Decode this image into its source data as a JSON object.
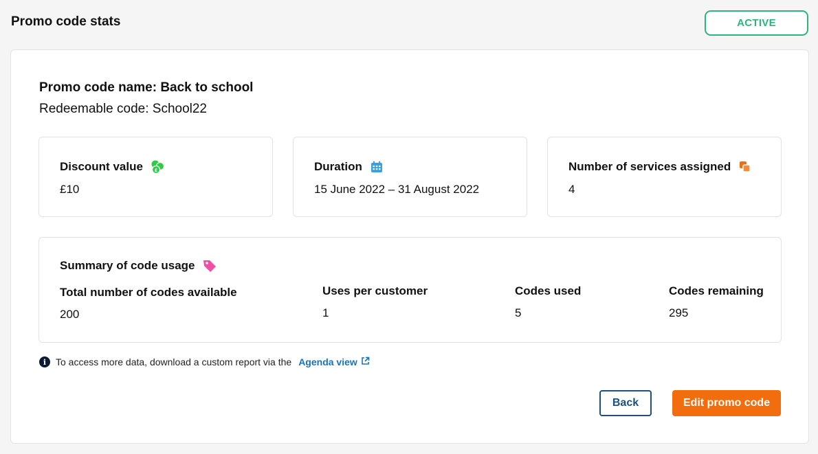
{
  "header": {
    "title": "Promo code stats",
    "status": "ACTIVE",
    "status_color": "#2fb37d"
  },
  "promo": {
    "name_line": "Promo code name: Back to school",
    "redeemable_line": "Redeemable code: School22"
  },
  "stats": [
    {
      "label": "Discount value",
      "value": "£10",
      "icon": "coins-icon",
      "icon_color": "#2ecc40"
    },
    {
      "label": "Duration",
      "value": "15 June 2022 – 31 August 2022",
      "icon": "calendar-icon",
      "icon_color": "#3aa0e0"
    },
    {
      "label": "Number of services assigned",
      "value": "4",
      "icon": "layers-icon",
      "icon_color": "#f26d0e"
    }
  ],
  "summary": {
    "title": "Summary of code usage",
    "icon": "tag-icon",
    "icon_color": "#ef4fa6",
    "columns": [
      {
        "header": "Total number of codes available",
        "value": "200"
      },
      {
        "header": "Uses per customer",
        "value": "1"
      },
      {
        "header": "Codes used",
        "value": "5"
      },
      {
        "header": "Codes remaining",
        "value": "295"
      }
    ]
  },
  "info": {
    "text": "To access more data, download a custom report via the",
    "link_label": "Agenda view"
  },
  "actions": {
    "back_label": "Back",
    "edit_label": "Edit promo code",
    "edit_color": "#f26d0e"
  }
}
